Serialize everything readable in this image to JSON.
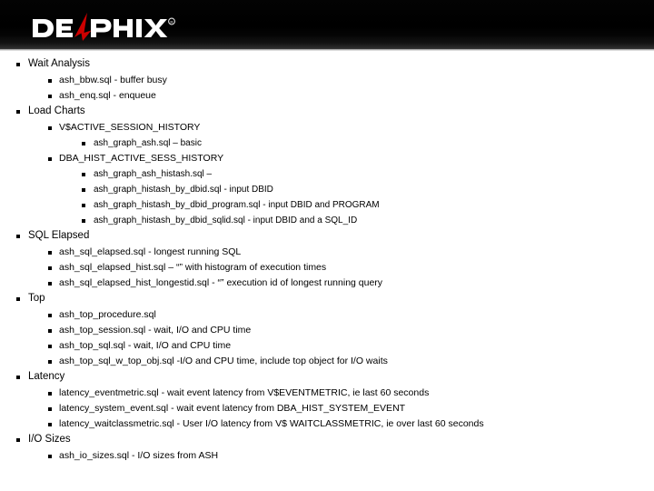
{
  "header": {
    "logo": {
      "name": "delphix-logo",
      "text_left": "DE",
      "text_right": "PHIX",
      "trademark": "®",
      "accent_color": "#cc0000",
      "text_color": "#ffffff",
      "background_color": "#000000"
    }
  },
  "outline": {
    "sections": [
      {
        "label": "Wait Analysis",
        "children": [
          {
            "level": 2,
            "label": "ash_bbw.sql - buffer busy"
          },
          {
            "level": 2,
            "label": "ash_enq.sql - enqueue"
          }
        ]
      },
      {
        "label": "Load Charts",
        "children": [
          {
            "level": 2,
            "label": "V$ACTIVE_SESSION_HISTORY"
          },
          {
            "level": 3,
            "label": "ash_graph_ash.sql – basic"
          },
          {
            "level": 2,
            "label": "DBA_HIST_ACTIVE_SESS_HISTORY"
          },
          {
            "level": 3,
            "label": "ash_graph_ash_histash.sql –"
          },
          {
            "level": 3,
            "label": "ash_graph_histash_by_dbid.sql - input DBID"
          },
          {
            "level": 3,
            "label": "ash_graph_histash_by_dbid_program.sql - input DBID and PROGRAM"
          },
          {
            "level": 3,
            "label": "ash_graph_histash_by_dbid_sqlid.sql - input DBID and a SQL_ID"
          }
        ]
      },
      {
        "label": "SQL Elapsed",
        "children": [
          {
            "level": 2,
            "label": "ash_sql_elapsed.sql - longest running SQL"
          },
          {
            "level": 2,
            "label": "ash_sql_elapsed_hist.sql – “” with histogram of execution times"
          },
          {
            "level": 2,
            "label": "ash_sql_elapsed_hist_longestid.sql -  “” execution id of longest running query"
          }
        ]
      },
      {
        "label": "Top",
        "children": [
          {
            "level": 2,
            "label": "ash_top_procedure.sql"
          },
          {
            "level": 2,
            "label": "ash_top_session.sql - wait, I/O and CPU time"
          },
          {
            "level": 2,
            "label": "ash_top_sql.sql - wait, I/O and CPU time"
          },
          {
            "level": 2,
            "label": "ash_top_sql_w_top_obj.sql -I/O and CPU time, include top object for I/O waits"
          }
        ]
      },
      {
        "label": "Latency",
        "children": [
          {
            "level": 2,
            "label": "latency_eventmetric.sql - wait event latency from V$EVENTMETRIC, ie last 60 seconds"
          },
          {
            "level": 2,
            "label": "latency_system_event.sql - wait event latency from DBA_HIST_SYSTEM_EVENT"
          },
          {
            "level": 2,
            "label": "latency_waitclassmetric.sql - User I/O  latency from V$ WAITCLASSMETRIC, ie  over last 60 seconds"
          }
        ]
      },
      {
        "label": "I/O Sizes",
        "children": [
          {
            "level": 2,
            "label": "ash_io_sizes.sql - I/O sizes from ASH"
          }
        ]
      }
    ]
  }
}
